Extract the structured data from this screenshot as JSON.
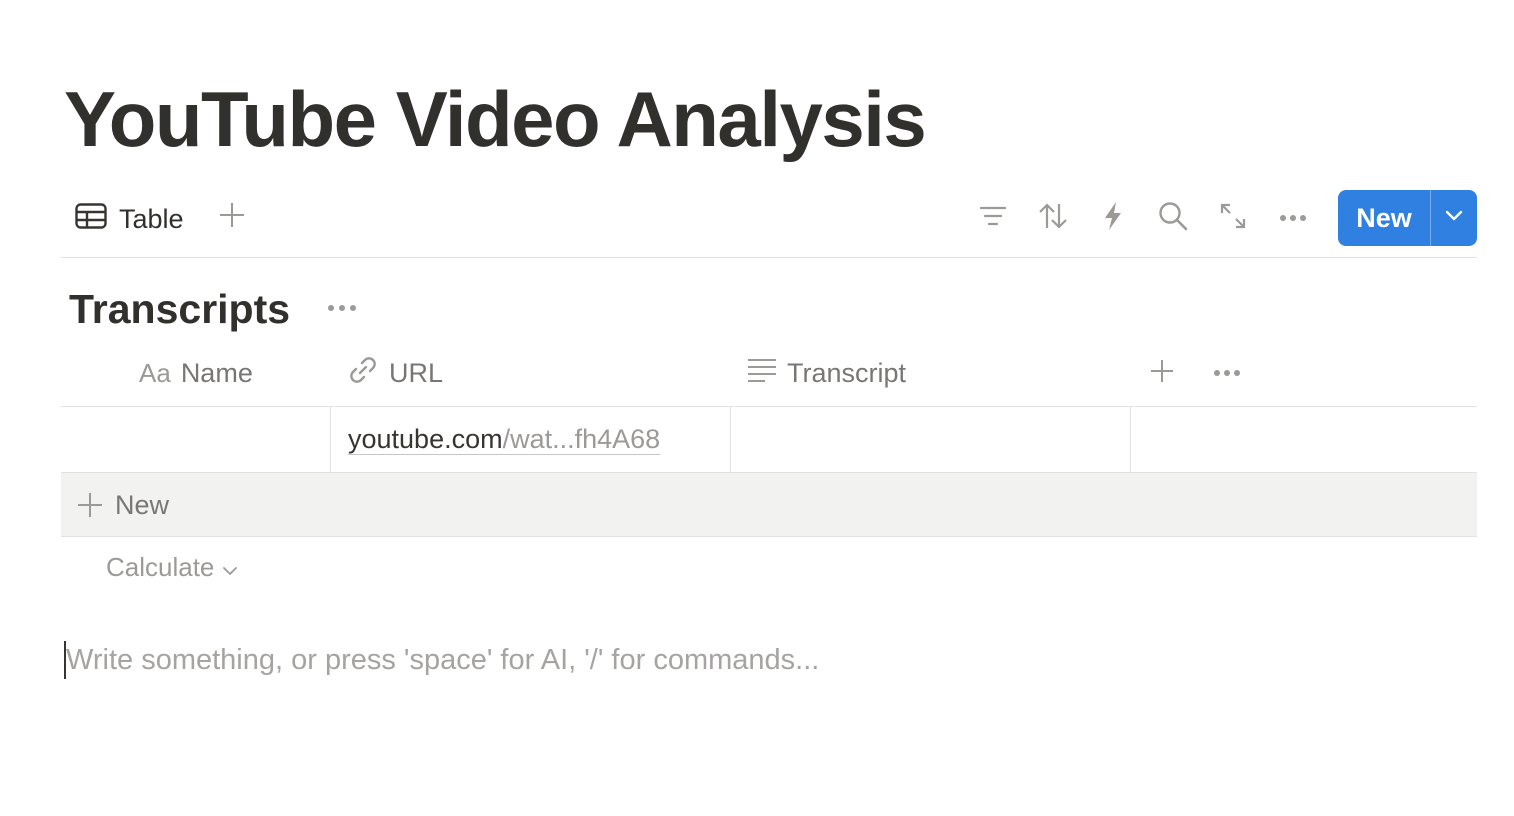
{
  "page": {
    "title": "YouTube Video Analysis"
  },
  "view_bar": {
    "tab_label": "Table",
    "tab_icon": "table-icon",
    "tools": [
      "filter-icon",
      "sort-icon",
      "automation-icon",
      "search-icon",
      "expand-icon",
      "more-icon"
    ],
    "new_button_label": "New"
  },
  "database": {
    "title": "Transcripts",
    "columns": [
      {
        "icon": "text-property-icon",
        "label": "Name"
      },
      {
        "icon": "link-icon",
        "label": "URL"
      },
      {
        "icon": "lines-icon",
        "label": "Transcript"
      }
    ],
    "name_icon_text": "Aa",
    "rows": [
      {
        "name": "",
        "url_host": "youtube.com",
        "url_path": "/wat...fh4A68",
        "transcript": ""
      }
    ],
    "new_row_label": "New",
    "calculate_label": "Calculate"
  },
  "editor": {
    "placeholder": "Write something, or press 'space' for AI, '/' for commands..."
  },
  "colors": {
    "accent": "#2f80e1",
    "text": "#37352f",
    "muted": "#787774",
    "border": "#e3e2e0",
    "new_row_bg": "#f2f2f1"
  }
}
